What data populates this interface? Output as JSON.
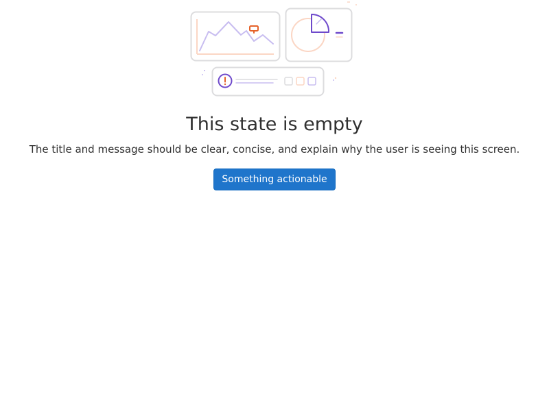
{
  "empty_state": {
    "illustration_icon": "empty-state-dashboard-illustration",
    "title": "This state is empty",
    "message": "The title and message should be clear, concise, and explain why the user is seeing this screen.",
    "action_label": "Something actionable"
  },
  "colors": {
    "primary_button": "#1f75cb",
    "illustration_purple": "#6e49cb",
    "illustration_orange": "#e5622a",
    "illustration_light_purple": "#c8bdf0",
    "illustration_peach": "#fbd6c4",
    "card_border": "#dcdcde"
  }
}
